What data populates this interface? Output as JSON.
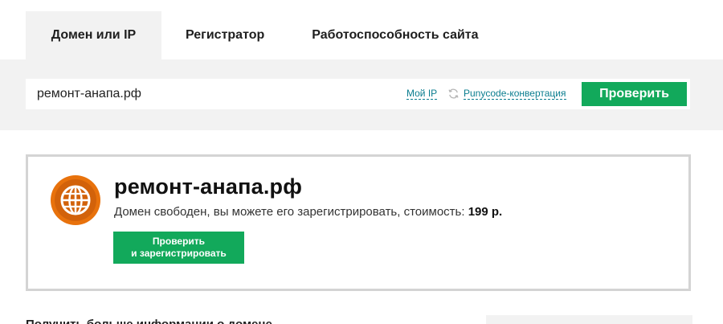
{
  "tabs": [
    {
      "label": "Домен или IP",
      "active": true
    },
    {
      "label": "Регистратор",
      "active": false
    },
    {
      "label": "Работоспособность сайта",
      "active": false
    }
  ],
  "search": {
    "value": "ремонт-анапа.рф",
    "my_ip_link": "Мой IP",
    "punycode_link": "Punycode-конвертация",
    "sync_icon": "sync-icon",
    "check_button": "Проверить"
  },
  "result": {
    "icon": "globe-icon",
    "domain": "ремонт-анапа.рф",
    "status_text": "Домен свободен, вы можете его зарегистрировать, стоимость:",
    "price": "199 р.",
    "register_button_line1": "Проверить",
    "register_button_line2": "и зарегистрировать"
  },
  "more_info": {
    "heading": "Получить больше информации о домене"
  },
  "colors": {
    "accent_green": "#12a95b",
    "link_teal": "#0a7d8f",
    "globe_orange": "#e8720c",
    "panel_gray": "#f2f2f2"
  }
}
